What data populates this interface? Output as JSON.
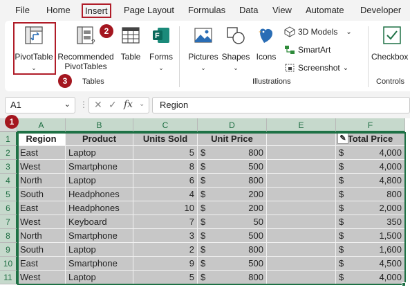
{
  "menu": {
    "items": [
      "File",
      "Home",
      "Insert",
      "Page Layout",
      "Formulas",
      "Data",
      "View",
      "Automate",
      "Developer"
    ],
    "active": "Insert"
  },
  "ribbon": {
    "pivottable_label": "PivotTable",
    "recommended_label_1": "Recommended",
    "recommended_label_2": "PivotTables",
    "table_label": "Table",
    "forms_label": "Forms",
    "tables_group": "Tables",
    "pictures_label": "Pictures",
    "shapes_label": "Shapes",
    "icons_label": "Icons",
    "models_label": "3D Models",
    "smartart_label": "SmartArt",
    "screenshot_label": "Screenshot",
    "illustrations_group": "Illustrations",
    "checkbox_label": "Checkbox",
    "controls_group": "Controls"
  },
  "badges": [
    "1",
    "2",
    "3"
  ],
  "formula_bar": {
    "name_box": "A1",
    "fx": "fx",
    "formula": "Region"
  },
  "columns": [
    "A",
    "B",
    "C",
    "D",
    "E",
    "F"
  ],
  "rows": [
    "1",
    "2",
    "3",
    "4",
    "5",
    "6",
    "7",
    "8",
    "9",
    "10",
    "11"
  ],
  "table": {
    "headers": [
      "Region",
      "Product",
      "Units Sold",
      "Unit Price",
      "",
      "Total Price"
    ],
    "currency_symbol": "$",
    "data": [
      [
        "East",
        "Laptop",
        "5",
        "800",
        "",
        "4,000"
      ],
      [
        "West",
        "Smartphone",
        "8",
        "500",
        "",
        "4,000"
      ],
      [
        "North",
        "Laptop",
        "6",
        "800",
        "",
        "4,800"
      ],
      [
        "South",
        "Headphones",
        "4",
        "200",
        "",
        "800"
      ],
      [
        "East",
        "Headphones",
        "10",
        "200",
        "",
        "2,000"
      ],
      [
        "West",
        "Keyboard",
        "7",
        "50",
        "",
        "350"
      ],
      [
        "North",
        "Smartphone",
        "3",
        "500",
        "",
        "1,500"
      ],
      [
        "South",
        "Laptop",
        "2",
        "800",
        "",
        "1,600"
      ],
      [
        "East",
        "Smartphone",
        "9",
        "500",
        "",
        "4,500"
      ],
      [
        "West",
        "Laptop",
        "5",
        "800",
        "",
        "4,000"
      ]
    ]
  },
  "colors": {
    "accent_red": "#b01c28",
    "badge_red": "#a4161f",
    "excel_green": "#1e7145",
    "selection_fill": "#c7c7c7"
  }
}
